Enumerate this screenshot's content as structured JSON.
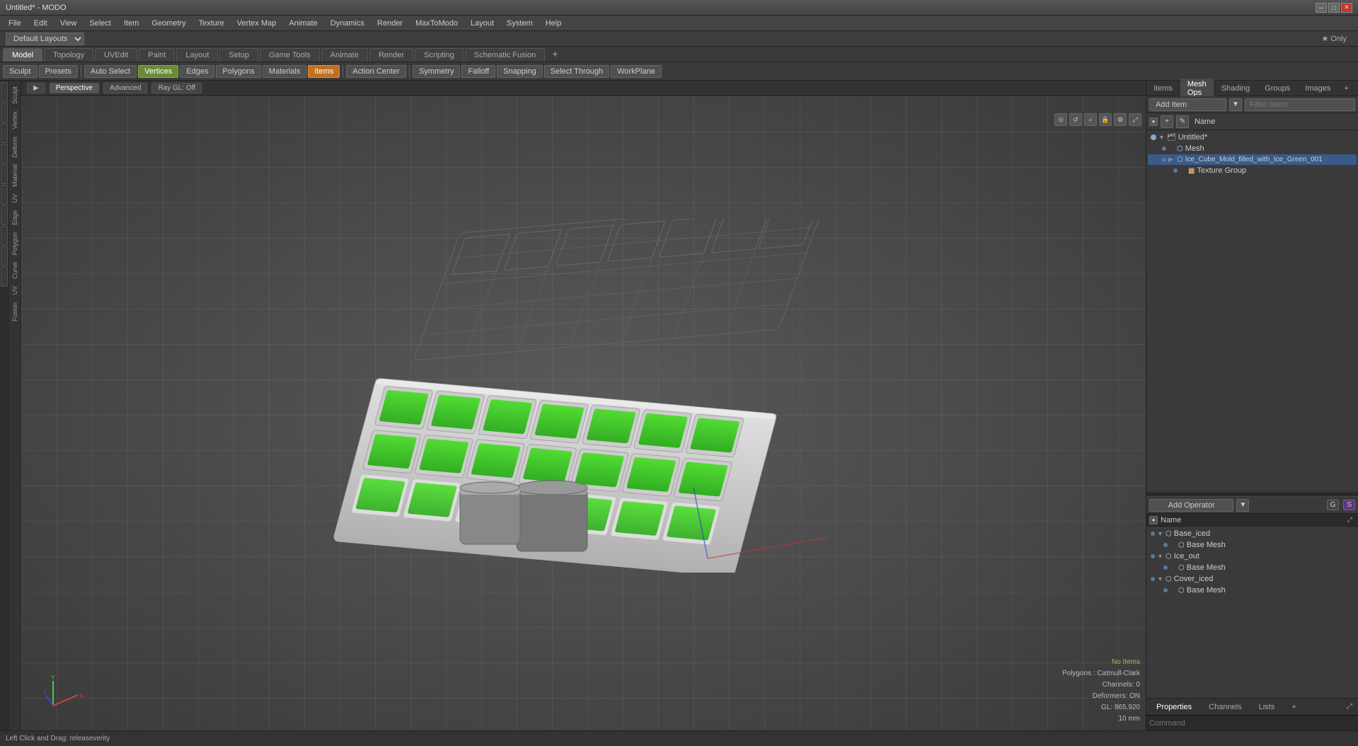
{
  "window": {
    "title": "Untitled* - MODO"
  },
  "menu": {
    "items": [
      "File",
      "Edit",
      "View",
      "Select",
      "Item",
      "Geometry",
      "Texture",
      "Vertex Map",
      "Animate",
      "Dynamics",
      "Render",
      "MaxToModo",
      "Layout",
      "System",
      "Help"
    ]
  },
  "layout": {
    "dropdown_label": "Default Layouts",
    "dropdown_arrow": "▼"
  },
  "tabs": {
    "items": [
      "Model",
      "Topology",
      "UVEdit",
      "Paint",
      "Layout",
      "Setup",
      "Game Tools",
      "Animate",
      "Render",
      "Scripting",
      "Schematic Fusion"
    ],
    "active": "Model",
    "plus": "+"
  },
  "toolbar": {
    "sculpt": "Sculpt",
    "presets": "Presets",
    "auto_select": "Auto Select",
    "vertices": "Vertices",
    "edges": "Edges",
    "polygons": "Polygons",
    "materials": "Materials",
    "items": "Items",
    "action_center": "Action Center",
    "symmetry": "Symmetry",
    "falloff": "Falloff",
    "snapping": "Snapping",
    "select_through": "Select Through",
    "workplane": "WorkPlane"
  },
  "viewport": {
    "perspective_label": "Perspective",
    "advanced_label": "Advanced",
    "ray_gl": "Ray GL: Off",
    "camera_icon": "⊙",
    "reset_icon": "↺",
    "zoom_icon": "⌕",
    "lock_icon": "🔒",
    "settings_icon": "⚙",
    "expand_icon": "⤢"
  },
  "viewport_info": {
    "no_items": "No Items",
    "polygons": "Polygons : Catmull-Clark",
    "channels": "Channels: 0",
    "deformers": "Deformers: ON",
    "gl_stats": "GL: 865,920",
    "distance": "10 mm"
  },
  "right_panel": {
    "tabs": [
      "Items",
      "Mesh Ops",
      "Shading",
      "Groups",
      "Images"
    ],
    "active_tab": "Mesh Ops",
    "plus": "+",
    "expand_icon": "⤢",
    "tools": {
      "add_icon": "+",
      "camera_icon": "👁",
      "edit_icon": "✎"
    },
    "name_header": "Name",
    "add_item_label": "Add Item",
    "filter_placeholder": "Filter Items",
    "scene_tree": [
      {
        "id": "untitled",
        "label": "Untitled*",
        "type": "scene",
        "expanded": true,
        "indent": 0,
        "children": [
          {
            "id": "mesh",
            "label": "Mesh",
            "type": "mesh",
            "indent": 1
          },
          {
            "id": "ice_cube_mold",
            "label": "Ice_Cube_Mold_filled_with_Ice_Green_001",
            "type": "mesh",
            "indent": 1,
            "expanded": true
          },
          {
            "id": "texture_group",
            "label": "Texture Group",
            "type": "texture",
            "indent": 2
          }
        ]
      }
    ]
  },
  "mesh_ops_panel": {
    "add_operator_label": "Add Operator",
    "name_header": "Name",
    "collapse_icon": "◀",
    "expand_icon": "⤢",
    "g_btn": "G",
    "s_btn": "S",
    "operators": [
      {
        "id": "base_iced",
        "label": "Base_iced",
        "expanded": true,
        "indent": 0,
        "children": [
          {
            "id": "base_mesh_1",
            "label": "Base Mesh",
            "indent": 1
          }
        ]
      },
      {
        "id": "ice_out",
        "label": "Ice_out",
        "expanded": true,
        "indent": 0,
        "children": [
          {
            "id": "base_mesh_2",
            "label": "Base Mesh",
            "indent": 1
          }
        ]
      },
      {
        "id": "cover_iced",
        "label": "Cover_iced",
        "expanded": true,
        "indent": 0,
        "children": [
          {
            "id": "base_mesh_3",
            "label": "Base Mesh",
            "indent": 1
          }
        ]
      }
    ]
  },
  "bottom_tabs": {
    "items": [
      "Properties",
      "Channels",
      "Lists"
    ],
    "active": "Properties",
    "plus": "+"
  },
  "command_bar": {
    "placeholder": "Command"
  },
  "status_bar": {
    "message": "Left Click and Drag:  releaseverity"
  },
  "left_side_labels": [
    "Sculpt",
    "Vertex",
    "Deform",
    "Material",
    "UV",
    "Edge",
    "Polygon",
    "Curve",
    "UV",
    "Fusion"
  ]
}
